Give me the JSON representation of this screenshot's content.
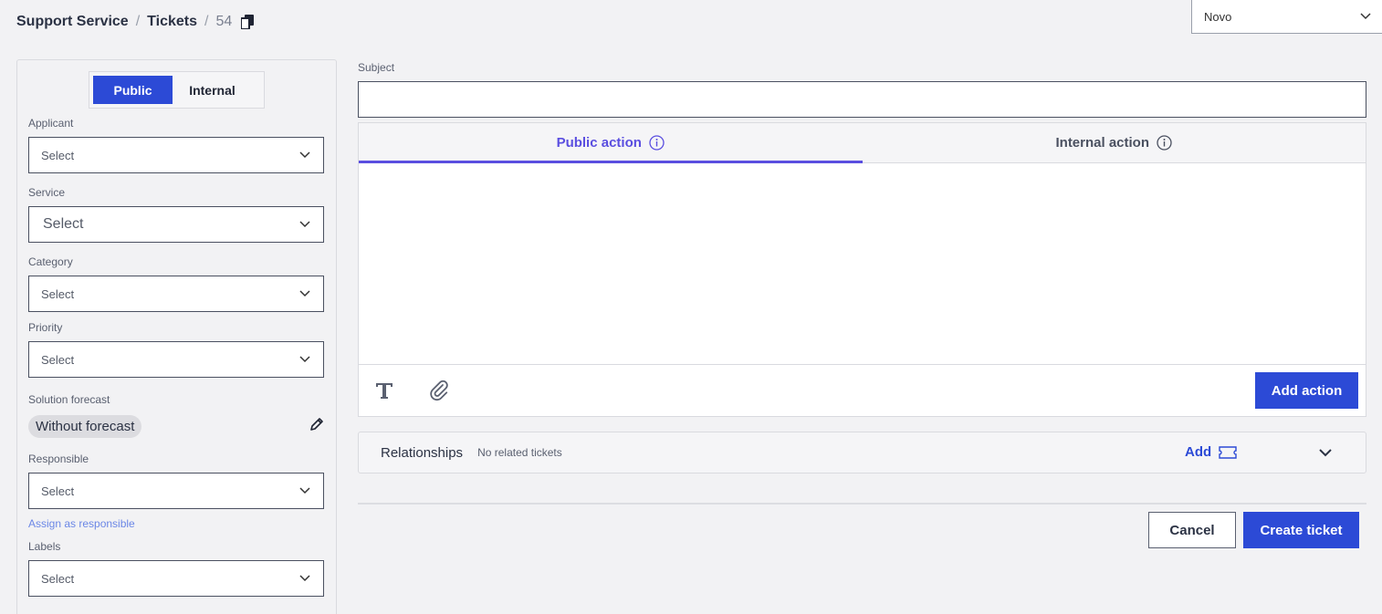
{
  "breadcrumb": {
    "service": "Support Service",
    "separator": "/",
    "section": "Tickets",
    "ticket_id": "54"
  },
  "status_select": {
    "value": "Novo"
  },
  "visibility": {
    "public": "Public",
    "internal": "Internal",
    "selected": "Public"
  },
  "fields": {
    "applicant": {
      "label": "Applicant",
      "value": "Select"
    },
    "service": {
      "label": "Service",
      "value": "Select"
    },
    "category": {
      "label": "Category",
      "value": "Select"
    },
    "priority": {
      "label": "Priority",
      "value": "Select"
    },
    "solution_forecast": {
      "label": "Solution forecast",
      "value": "Without forecast"
    },
    "responsible": {
      "label": "Responsible",
      "value": "Select",
      "assign_link": "Assign as responsible"
    },
    "labels": {
      "label": "Labels",
      "value": "Select"
    }
  },
  "subject": {
    "label": "Subject",
    "value": ""
  },
  "editor": {
    "tabs": [
      {
        "label": "Public action",
        "active": true
      },
      {
        "label": "Internal action",
        "active": false
      }
    ],
    "add_action": "Add action"
  },
  "relationships": {
    "title": "Relationships",
    "subtitle": "No related tickets",
    "add": "Add"
  },
  "footer": {
    "cancel": "Cancel",
    "create": "Create ticket"
  },
  "colors": {
    "primary": "#2c4ad6",
    "accent_tab": "#5a4ee0"
  }
}
